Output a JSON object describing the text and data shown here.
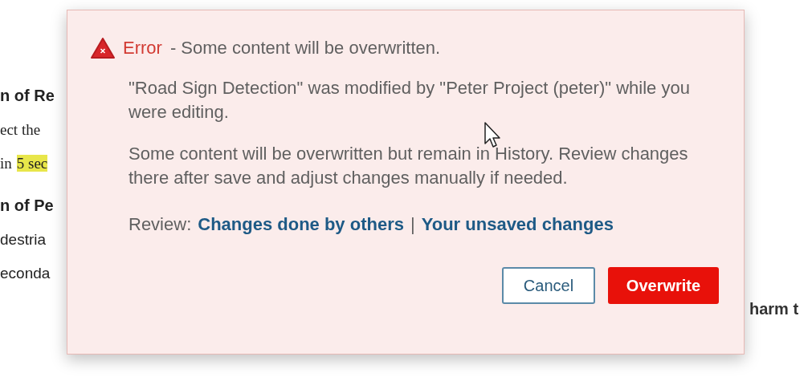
{
  "background_page": {
    "left_lines": [
      {
        "kind": "heading",
        "segments": [
          {
            "text": "n of Re",
            "highlighted": false
          }
        ]
      },
      {
        "kind": "serif",
        "segments": [
          {
            "text": "ect the",
            "highlighted": false
          }
        ]
      },
      {
        "kind": "serif",
        "segments": [
          {
            "text": "in",
            "highlighted": false
          },
          {
            "text": "5 sec",
            "highlighted": true
          }
        ]
      },
      {
        "kind": "heading",
        "segments": [
          {
            "text": "n of Pe",
            "highlighted": false
          }
        ]
      },
      {
        "kind": "body",
        "segments": [
          {
            "text": "destria",
            "highlighted": false
          }
        ]
      },
      {
        "kind": "body",
        "segments": [
          {
            "text": "econda",
            "highlighted": false
          }
        ]
      }
    ],
    "right_lines": [
      "harm t"
    ]
  },
  "dialog": {
    "title_label": "Error",
    "title_message": "- Some content will be overwritten.",
    "paragraphs": [
      "\"Road Sign Detection\" was modified by \"Peter Project (peter)\" while you were editing.",
      "Some content will be overwritten but remain in History. Review changes there after save and adjust changes manually if needed."
    ],
    "review": {
      "label": "Review:",
      "links": [
        "Changes done by others",
        "Your unsaved changes"
      ],
      "separator": "|"
    },
    "buttons": [
      {
        "label": "Cancel",
        "kind": "secondary"
      },
      {
        "label": "Overwrite",
        "kind": "primary"
      }
    ]
  }
}
